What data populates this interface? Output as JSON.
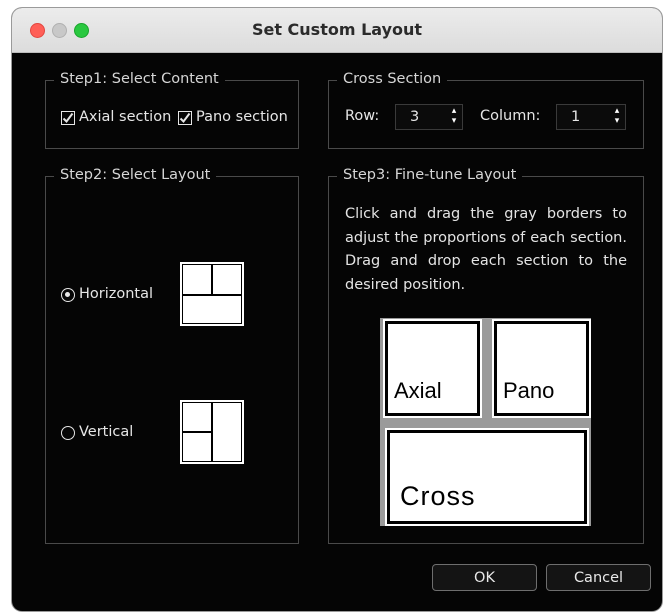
{
  "window": {
    "title": "Set Custom Layout"
  },
  "step1": {
    "legend": "Step1: Select Content",
    "axial": {
      "label": "Axial section",
      "checked": true
    },
    "pano": {
      "label": "Pano section",
      "checked": true
    }
  },
  "cross_section": {
    "legend": "Cross Section",
    "row_label": "Row:",
    "row_value": "3",
    "column_label": "Column:",
    "column_value": "1",
    "spin_up": "▴",
    "spin_down": "▾"
  },
  "step2": {
    "legend": "Step2: Select Layout",
    "horizontal": {
      "label": "Horizontal",
      "selected": true
    },
    "vertical": {
      "label": "Vertical",
      "selected": false
    }
  },
  "step3": {
    "legend": "Step3: Fine-tune Layout",
    "instructions": "Click and drag the gray borders to adjust the proportions of each section. Drag and drop each section to the desired position.",
    "preview": {
      "axial": "Axial",
      "pano": "Pano",
      "cross": "Cross"
    }
  },
  "buttons": {
    "ok": "OK",
    "cancel": "Cancel"
  }
}
